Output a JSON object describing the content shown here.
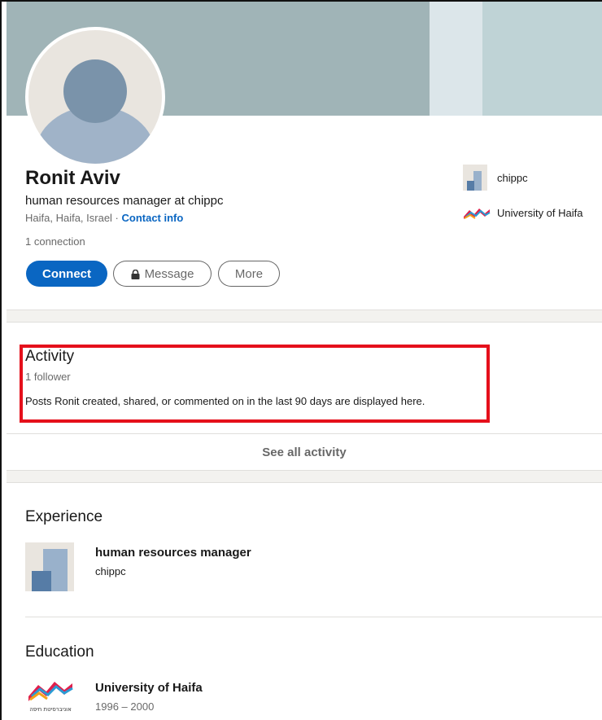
{
  "profile": {
    "name": "Ronit Aviv",
    "headline": "human resources manager at chippc",
    "location": "Haifa, Haifa, Israel",
    "location_separator": " · ",
    "contact_info_link": "Contact info",
    "connections": "1 connection"
  },
  "actions": {
    "connect": "Connect",
    "message": "Message",
    "more": "More"
  },
  "sidebar": {
    "company": "chippc",
    "school": "University of Haifa"
  },
  "activity": {
    "title": "Activity",
    "followers": "1 follower",
    "description": "Posts Ronit created, shared, or commented on in the last 90 days are displayed here.",
    "see_all": "See all activity"
  },
  "experience": {
    "title": "Experience",
    "items": [
      {
        "role": "human resources manager",
        "company": "chippc"
      }
    ]
  },
  "education": {
    "title": "Education",
    "items": [
      {
        "school": "University of Haifa",
        "dates": "1996 – 2000",
        "logo_caption": "אוניברסיטת חיפה"
      }
    ]
  },
  "colors": {
    "primary": "#0a66c2",
    "highlight_box": "#e5101b",
    "banner": "#a0b4b7"
  }
}
